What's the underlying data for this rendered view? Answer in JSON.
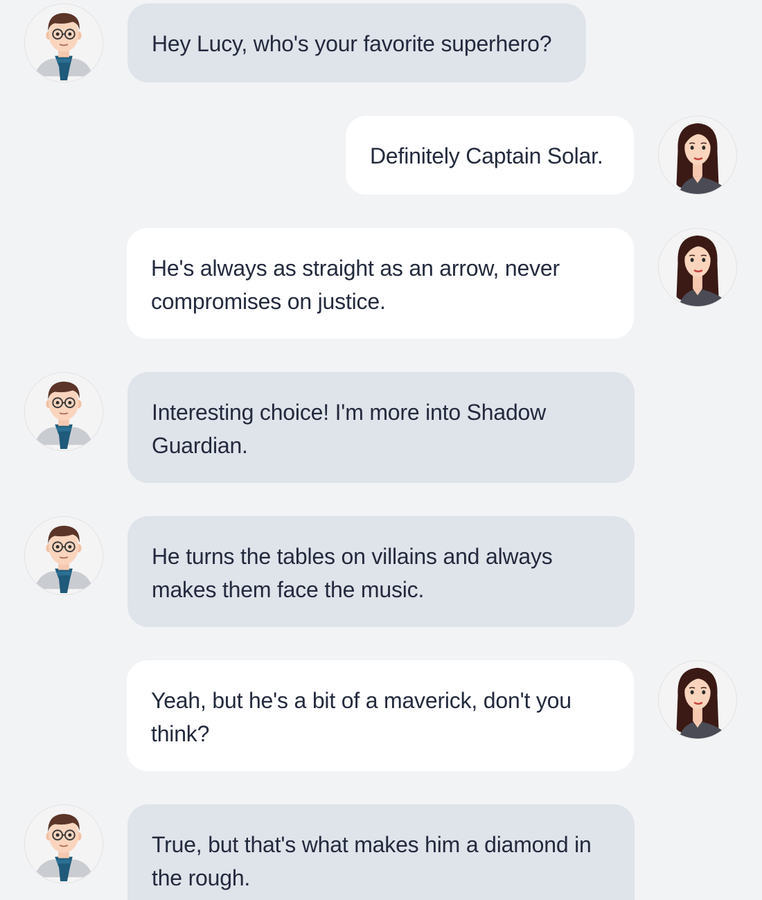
{
  "conversation": {
    "messages": [
      {
        "speaker": "male",
        "text": "Hey Lucy, who's your favorite superhero?"
      },
      {
        "speaker": "female",
        "text": "Definitely Captain Solar."
      },
      {
        "speaker": "female",
        "text": "He's always as straight as an arrow, never compromises on justice."
      },
      {
        "speaker": "male",
        "text": "Interesting choice! I'm more into Shadow Guardian."
      },
      {
        "speaker": "male",
        "text": "He turns the tables on villains and always makes them face the music."
      },
      {
        "speaker": "female",
        "text": "Yeah, but he's a bit of a maverick, don't you think?"
      },
      {
        "speaker": "male",
        "text": "True, but that's what makes him a diamond in the rough."
      }
    ]
  },
  "colors": {
    "background": "#f2f3f5",
    "male_bubble": "#dfe3ea",
    "female_bubble": "#ffffff",
    "text": "#232a3d"
  },
  "icons": {
    "male_avatar": "man-with-glasses-and-scarf-icon",
    "female_avatar": "woman-with-long-hair-icon"
  }
}
